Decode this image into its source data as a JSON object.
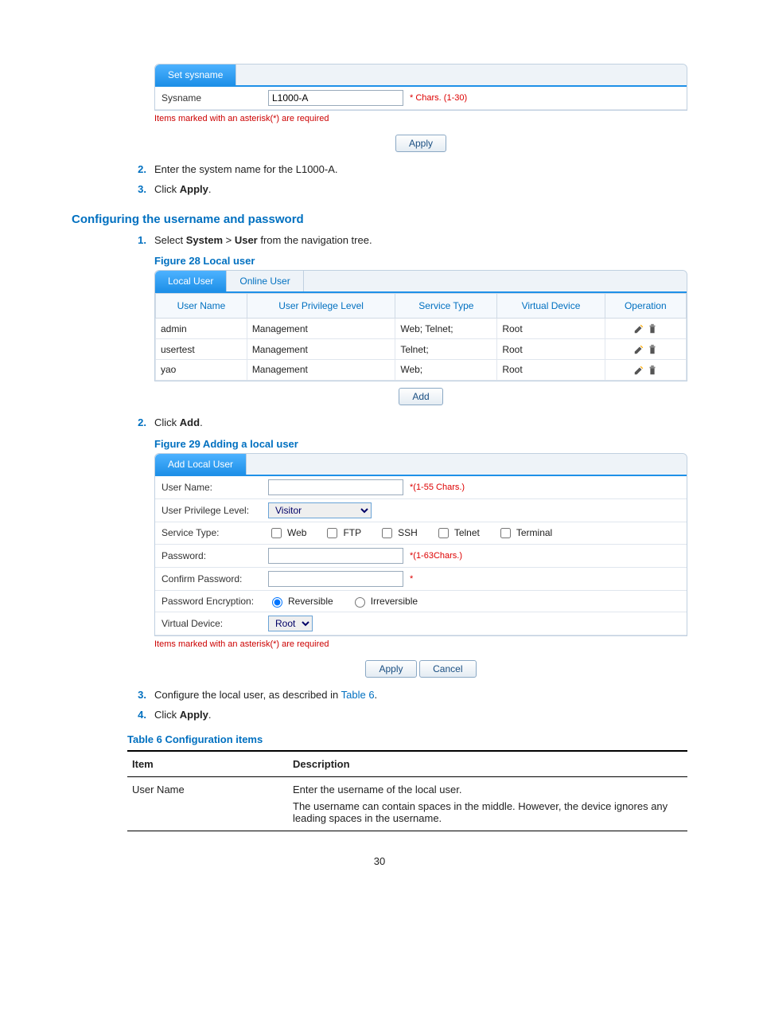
{
  "sysname_panel": {
    "tab_label": "Set sysname",
    "field_label": "Sysname",
    "field_value": "L1000-A",
    "hint": "* Chars. (1-30)",
    "asterisk_note": "Items marked with an asterisk(*) are required",
    "apply_btn": "Apply"
  },
  "step2_intro": "Enter the system name for the L1000-A.",
  "step3_intro_prefix": "Click ",
  "step3_intro_bold": "Apply",
  "step3_intro_suffix": ".",
  "heading_cfg": "Configuring the username and password",
  "step1_nav_prefix": "Select ",
  "step1_nav_b1": "System",
  "step1_nav_mid": " > ",
  "step1_nav_b2": "User",
  "step1_nav_suffix": " from the navigation tree.",
  "fig28_caption": "Figure 28 Local user",
  "user_panel": {
    "tab_active": "Local User",
    "tab_inactive": "Online User",
    "cols": {
      "c1": "User Name",
      "c2": "User Privilege Level",
      "c3": "Service Type",
      "c4": "Virtual Device",
      "c5": "Operation"
    },
    "rows": [
      {
        "name": "admin",
        "priv": "Management",
        "svc": "Web; Telnet;",
        "vd": "Root"
      },
      {
        "name": "usertest",
        "priv": "Management",
        "svc": "Telnet;",
        "vd": "Root"
      },
      {
        "name": "yao",
        "priv": "Management",
        "svc": "Web;",
        "vd": "Root"
      }
    ],
    "add_btn": "Add"
  },
  "step2b_prefix": "Click ",
  "step2b_bold": "Add",
  "step2b_suffix": ".",
  "fig29_caption": "Figure 29 Adding a local user",
  "add_panel": {
    "tab": "Add Local User",
    "username_lbl": "User Name:",
    "username_hint": "*(1-55 Chars.)",
    "priv_lbl": "User Privilege Level:",
    "priv_value": "Visitor",
    "svc_lbl": "Service Type:",
    "svc_opts": {
      "web": "Web",
      "ftp": "FTP",
      "ssh": "SSH",
      "telnet": "Telnet",
      "terminal": "Terminal"
    },
    "pwd_lbl": "Password:",
    "pwd_hint": "*(1-63Chars.)",
    "cpwd_lbl": "Confirm Password:",
    "cpwd_hint": "*",
    "enc_lbl": "Password Encryption:",
    "enc_rev": "Reversible",
    "enc_irr": "Irreversible",
    "vd_lbl": "Virtual Device:",
    "vd_value": "Root",
    "asterisk_note": "Items marked with an asterisk(*) are required",
    "apply_btn": "Apply",
    "cancel_btn": "Cancel"
  },
  "step3b_prefix": "Configure the local user, as described in ",
  "step3b_link": "Table 6",
  "step3b_suffix": ".",
  "step4b_prefix": "Click ",
  "step4b_bold": "Apply",
  "step4b_suffix": ".",
  "table6_caption": "Table 6 Configuration items",
  "table6": {
    "h1": "Item",
    "h2": "Description",
    "r1c1": "User Name",
    "r1c2a": "Enter the username of the local user.",
    "r1c2b": "The username can contain spaces in the middle. However, the device ignores any leading spaces in the username."
  },
  "page_number": "30"
}
